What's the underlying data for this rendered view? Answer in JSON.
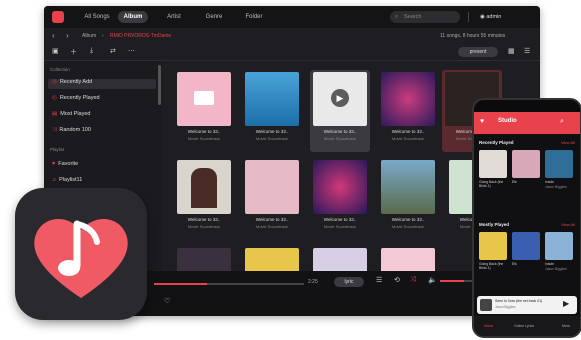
{
  "nav": {
    "tabs": [
      "All Songs",
      "Album",
      "Artist",
      "Genre",
      "Folder"
    ],
    "active": "Album",
    "search_placeholder": "Search",
    "user": "admin"
  },
  "toolbar": {
    "back": "‹",
    "forward": "›",
    "crumb_parent": "Album",
    "crumb_sep": "›",
    "crumb_current": "RMiO PRVOROS-TmDanie",
    "summary": "11 songs, 8 hours 55 minutes",
    "import_label": "present"
  },
  "sidebar": {
    "collection_heading": "Collection",
    "collection": [
      "Recently Add",
      "Recently Played",
      "Most Played",
      "Random 100"
    ],
    "playlist_heading": "Playlist",
    "playlists": [
      "Favorite",
      "Playlist11"
    ]
  },
  "albums": [
    {
      "title": "Welcome to 33..",
      "subtitle": "Movie Soundtrack"
    },
    {
      "title": "Welcome to 33..",
      "subtitle": "Movie Soundtrack"
    },
    {
      "title": "Welcome to 33..",
      "subtitle": "Movie Soundtrack"
    },
    {
      "title": "Welcome to 33..",
      "subtitle": "Movie Soundtrack"
    },
    {
      "title": "Welcome to 33..",
      "subtitle": "Movie Soundtrack"
    },
    {
      "title": "Welcome to 33..",
      "subtitle": "Movie Soundtrack"
    },
    {
      "title": "Welcome to 33..",
      "subtitle": "Movie Soundtrack"
    },
    {
      "title": "Welcome to 33..",
      "subtitle": "Movie Soundtrack"
    },
    {
      "title": "Welcome to 33..",
      "subtitle": "Movie Soundtrack"
    },
    {
      "title": "Welcome to 33..",
      "subtitle": "Movie Soundtrack"
    }
  ],
  "player": {
    "time": "2:25",
    "lyrics_label": "lyric"
  },
  "phone": {
    "title": "Studio",
    "recently_played": "Recently Played",
    "view_all": "View All",
    "recent_items": [
      {
        "title": "Going Back (the Birds 1)",
        "artist": ""
      },
      {
        "title": "Elk",
        "artist": ""
      },
      {
        "title": "Inside",
        "artist": "Jason Bigglew"
      }
    ],
    "mostly_played": "Mostly Played",
    "mostly_items": [
      {
        "title": "Going Back (the Birds 1)",
        "artist": ""
      },
      {
        "title": "Elk",
        "artist": ""
      },
      {
        "title": "Inside",
        "artist": "Jason Bigglew"
      }
    ],
    "mini_title": "Seen to Now (the set track 01)",
    "mini_artist": "Jason Bigglew",
    "bottom_nav": [
      "Home",
      "Online Lyrics",
      "More"
    ]
  },
  "colors": {
    "accent": "#e8424c",
    "window_bg": "#1e1e22",
    "sidebar_bg": "#1b1b1f"
  }
}
